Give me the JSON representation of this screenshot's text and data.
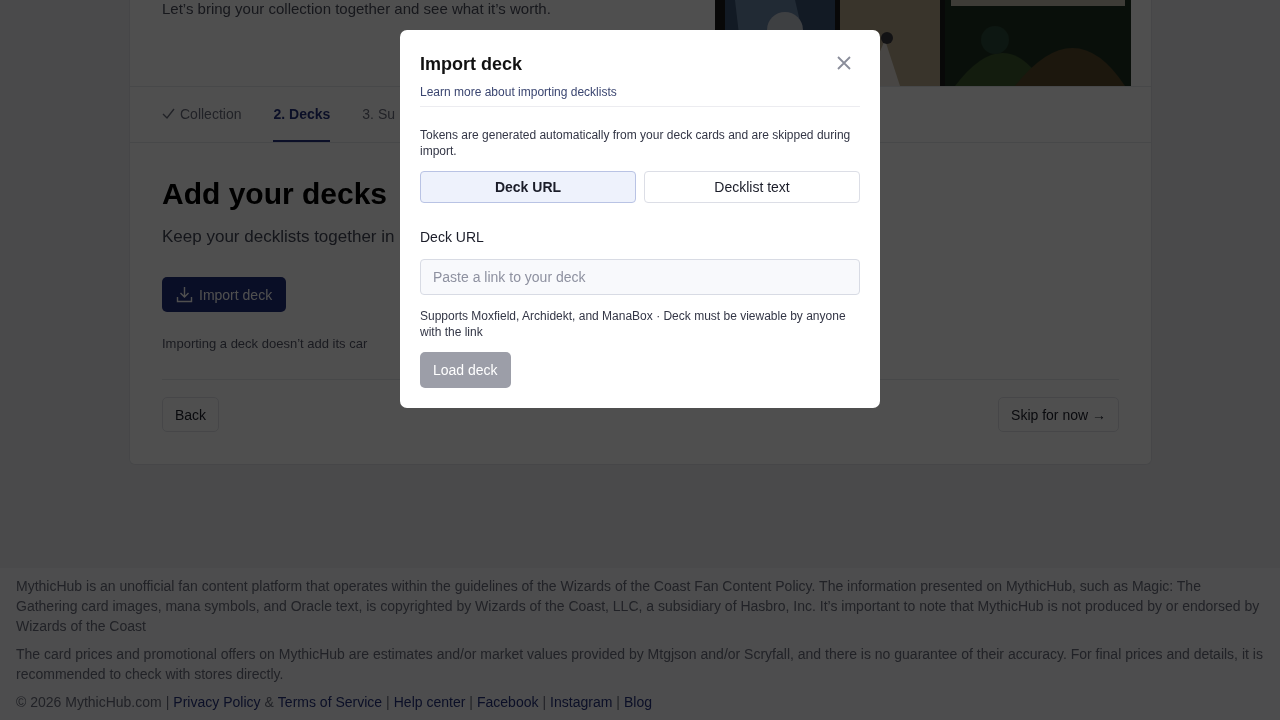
{
  "hero": {
    "subtitle": "Let’s bring your collection together and see what it’s worth."
  },
  "steps": [
    {
      "label": "Collection",
      "done": true,
      "selected": false
    },
    {
      "label": "2. Decks",
      "done": false,
      "selected": true
    },
    {
      "label": "3. Su",
      "done": false,
      "selected": false
    }
  ],
  "section": {
    "title": "Add your decks",
    "subtitle": "Keep your decklists together in",
    "import_button": "Import deck",
    "note": "Importing a deck doesn’t add its car"
  },
  "nav": {
    "back": "Back",
    "skip": "Skip for now →"
  },
  "footer": {
    "paragraphs": [
      "MythicHub is an unofficial fan content platform that operates within the guidelines of the Wizards of the Coast Fan Content Policy. The information presented on MythicHub, such as Magic: The Gathering card images, mana symbols, and Oracle text, is copyrighted by Wizards of the Coast, LLC, a subsidiary of Hasbro, Inc. It’s important to note that MythicHub is not produced by or endorsed by Wizards of the Coast",
      "The card prices and promotional offers on MythicHub are estimates and/or market values provided by Mtgjson and/or Scryfall, and there is no guarantee of their accuracy. For final prices and details, it is recommended to check with stores directly."
    ],
    "line": [
      {
        "kind": "text",
        "text": "© 2026 MythicHub.com"
      },
      {
        "kind": "sep",
        "text": "|"
      },
      {
        "kind": "link",
        "text": "Privacy Policy"
      },
      {
        "kind": "sep",
        "text": "&"
      },
      {
        "kind": "link",
        "text": "Terms of Service"
      },
      {
        "kind": "sep",
        "text": "|"
      },
      {
        "kind": "link",
        "text": "Help center"
      },
      {
        "kind": "sep",
        "text": "|"
      },
      {
        "kind": "link",
        "text": "Facebook"
      },
      {
        "kind": "sep",
        "text": "|"
      },
      {
        "kind": "link",
        "text": "Instagram"
      },
      {
        "kind": "sep",
        "text": "|"
      },
      {
        "kind": "link",
        "text": "Blog"
      }
    ]
  },
  "modal": {
    "title": "Import deck",
    "link": "Learn more about importing decklists",
    "note": "Tokens are generated automatically from your deck cards and are skipped during import.",
    "modes": [
      {
        "label": "Deck URL",
        "selected": true
      },
      {
        "label": "Decklist text",
        "selected": false
      }
    ],
    "field": {
      "label": "Deck URL",
      "placeholder": "Paste a link to your deck"
    },
    "help": "Supports Moxfield, Archidekt, and ManaBox · Deck must be viewable by anyone with the link",
    "submit": {
      "label": "Load deck",
      "disabled": true
    }
  }
}
